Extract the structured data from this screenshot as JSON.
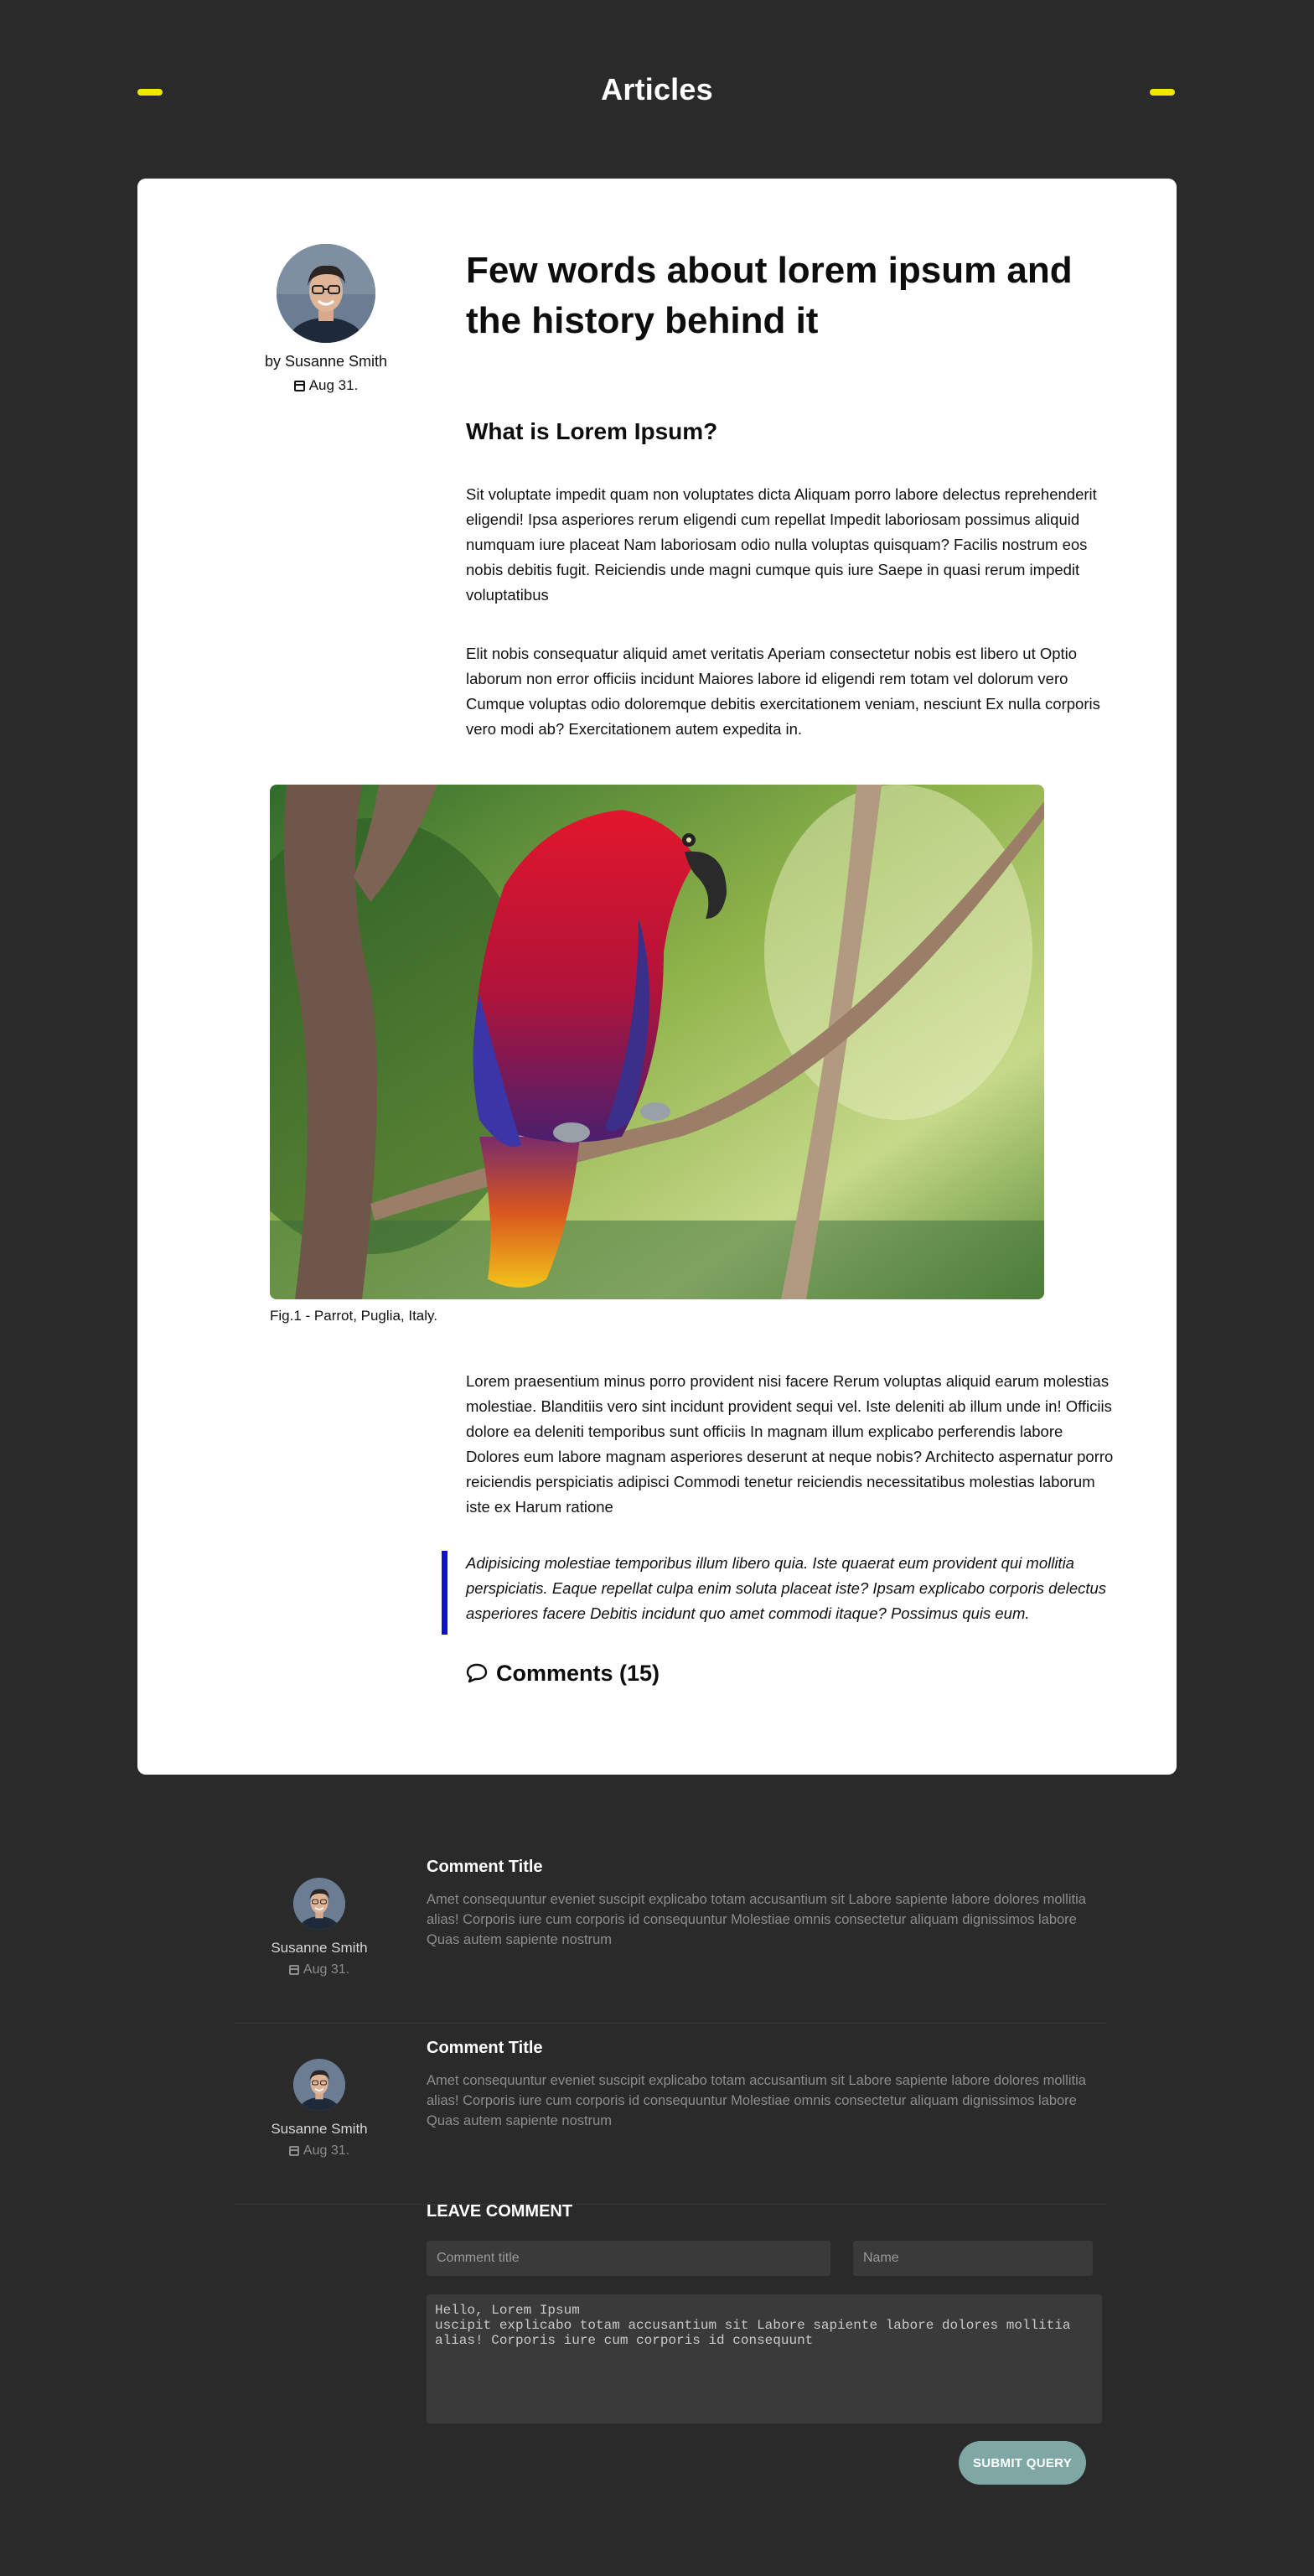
{
  "header": {
    "title": "Articles"
  },
  "article": {
    "author": {
      "name": "by Susanne Smith",
      "date": "Aug 31."
    },
    "title": "Few words about lorem ipsum and the history behind it",
    "subtitle": "What is Lorem Ipsum?",
    "paragraph1": "Sit voluptate impedit quam non voluptates dicta Aliquam porro labore delectus reprehenderit eligendi! Ipsa asperiores rerum eligendi cum repellat Impedit laboriosam possimus aliquid numquam iure placeat Nam laboriosam odio nulla voluptas quisquam? Facilis nostrum eos nobis debitis fugit. Reiciendis unde magni cumque quis iure Saepe in quasi rerum impedit voluptatibus",
    "paragraph2": "Elit nobis consequatur aliquid amet veritatis Aperiam consectetur nobis est libero ut Optio laborum non error officiis incidunt Maiores labore id eligendi rem totam vel dolorum vero Cumque voluptas odio doloremque debitis exercitationem veniam, nesciunt Ex nulla corporis vero modi ab? Exercitationem autem expedita in.",
    "figure_caption": "Fig.1 - Parrot, Puglia, Italy.",
    "paragraph3": "Lorem praesentium minus porro provident nisi facere Rerum voluptas aliquid earum molestias molestiae. Blanditiis vero sint incidunt provident sequi vel. Iste deleniti ab illum unde in! Officiis dolore ea deleniti temporibus sunt officiis In magnam illum explicabo perferendis labore Dolores eum labore magnam asperiores deserunt at neque nobis? Architecto aspernatur porro reiciendis perspiciatis adipisci Commodi tenetur reiciendis necessitatibus molestias laborum iste ex Harum ratione",
    "quote": "Adipisicing molestiae temporibus illum libero quia. Iste quaerat eum provident qui mollitia perspiciatis. Eaque repellat culpa enim soluta placeat iste? Ipsam explicabo corporis delectus asperiores facere Debitis incidunt quo amet commodi itaque? Possimus quis eum.",
    "comments_heading": "Comments (15)"
  },
  "comments": [
    {
      "name": "Susanne Smith",
      "date": "Aug 31.",
      "title": "Comment Title",
      "body": "Amet consequuntur eveniet suscipit explicabo totam accusantium sit Labore sapiente labore dolores mollitia alias! Corporis iure cum corporis id consequuntur Molestiae omnis consectetur aliquam dignissimos labore Quas autem sapiente nostrum"
    },
    {
      "name": "Susanne Smith",
      "date": "Aug 31.",
      "title": "Comment Title",
      "body": "Amet consequuntur eveniet suscipit explicabo totam accusantium sit Labore sapiente labore dolores mollitia alias! Corporis iure cum corporis id consequuntur Molestiae omnis consectetur aliquam dignissimos labore Quas autem sapiente nostrum"
    }
  ],
  "leave_comment": {
    "title": "LEAVE COMMENT",
    "title_placeholder": "Comment title",
    "name_placeholder": "Name",
    "message": "Hello, Lorem Ipsum\nuscipit explicabo totam accusantium sit Labore sapiente labore dolores mollitia alias! Corporis iure cum corporis id consequunt",
    "submit_label": "SUBMIT QUERY"
  },
  "colors": {
    "background": "#2a2a2a",
    "accent_yellow": "#f2e600",
    "quote_bar": "#1010d0",
    "submit": "#7fa8a4"
  }
}
